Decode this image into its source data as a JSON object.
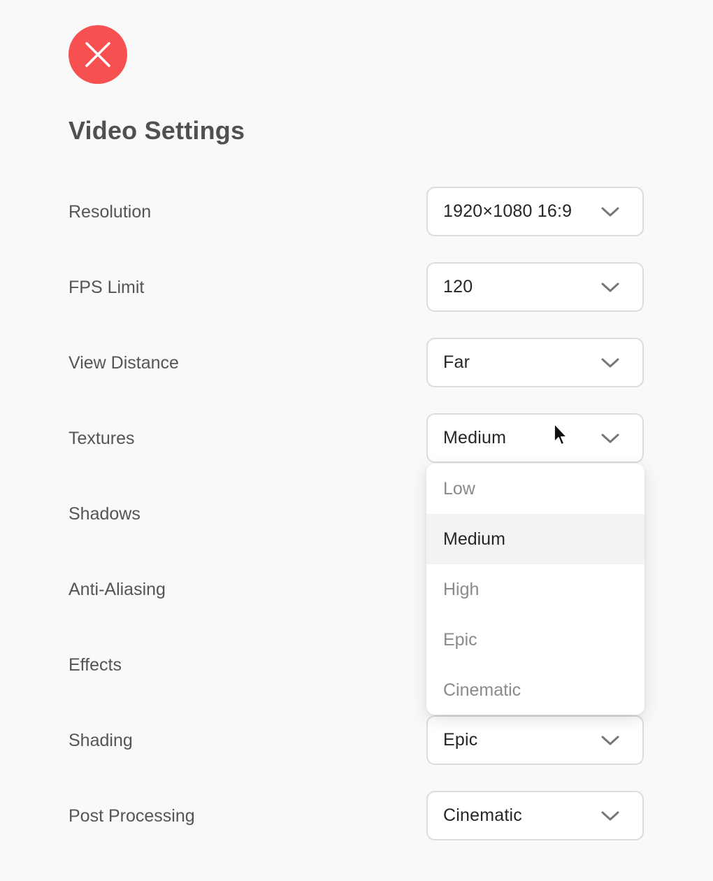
{
  "window": {
    "close_icon": "close-icon",
    "close_color": "#f75050"
  },
  "page": {
    "title": "Video Settings"
  },
  "settings": [
    {
      "label": "Resolution",
      "value": "1920×1080 16:9"
    },
    {
      "label": "FPS Limit",
      "value": "120"
    },
    {
      "label": "View Distance",
      "value": "Far"
    },
    {
      "label": "Textures",
      "value": "Medium"
    },
    {
      "label": "Shadows",
      "value": ""
    },
    {
      "label": "Anti-Aliasing",
      "value": ""
    },
    {
      "label": "Effects",
      "value": ""
    },
    {
      "label": "Shading",
      "value": "Epic"
    },
    {
      "label": "Post Processing",
      "value": "Cinematic"
    }
  ],
  "textures_dropdown": {
    "selected": "Medium",
    "options": [
      "Low",
      "Medium",
      "High",
      "Epic",
      "Cinematic"
    ]
  },
  "icons": {
    "select_chevron": "chevron-down-icon",
    "pointer": "mouse-pointer-icon"
  }
}
